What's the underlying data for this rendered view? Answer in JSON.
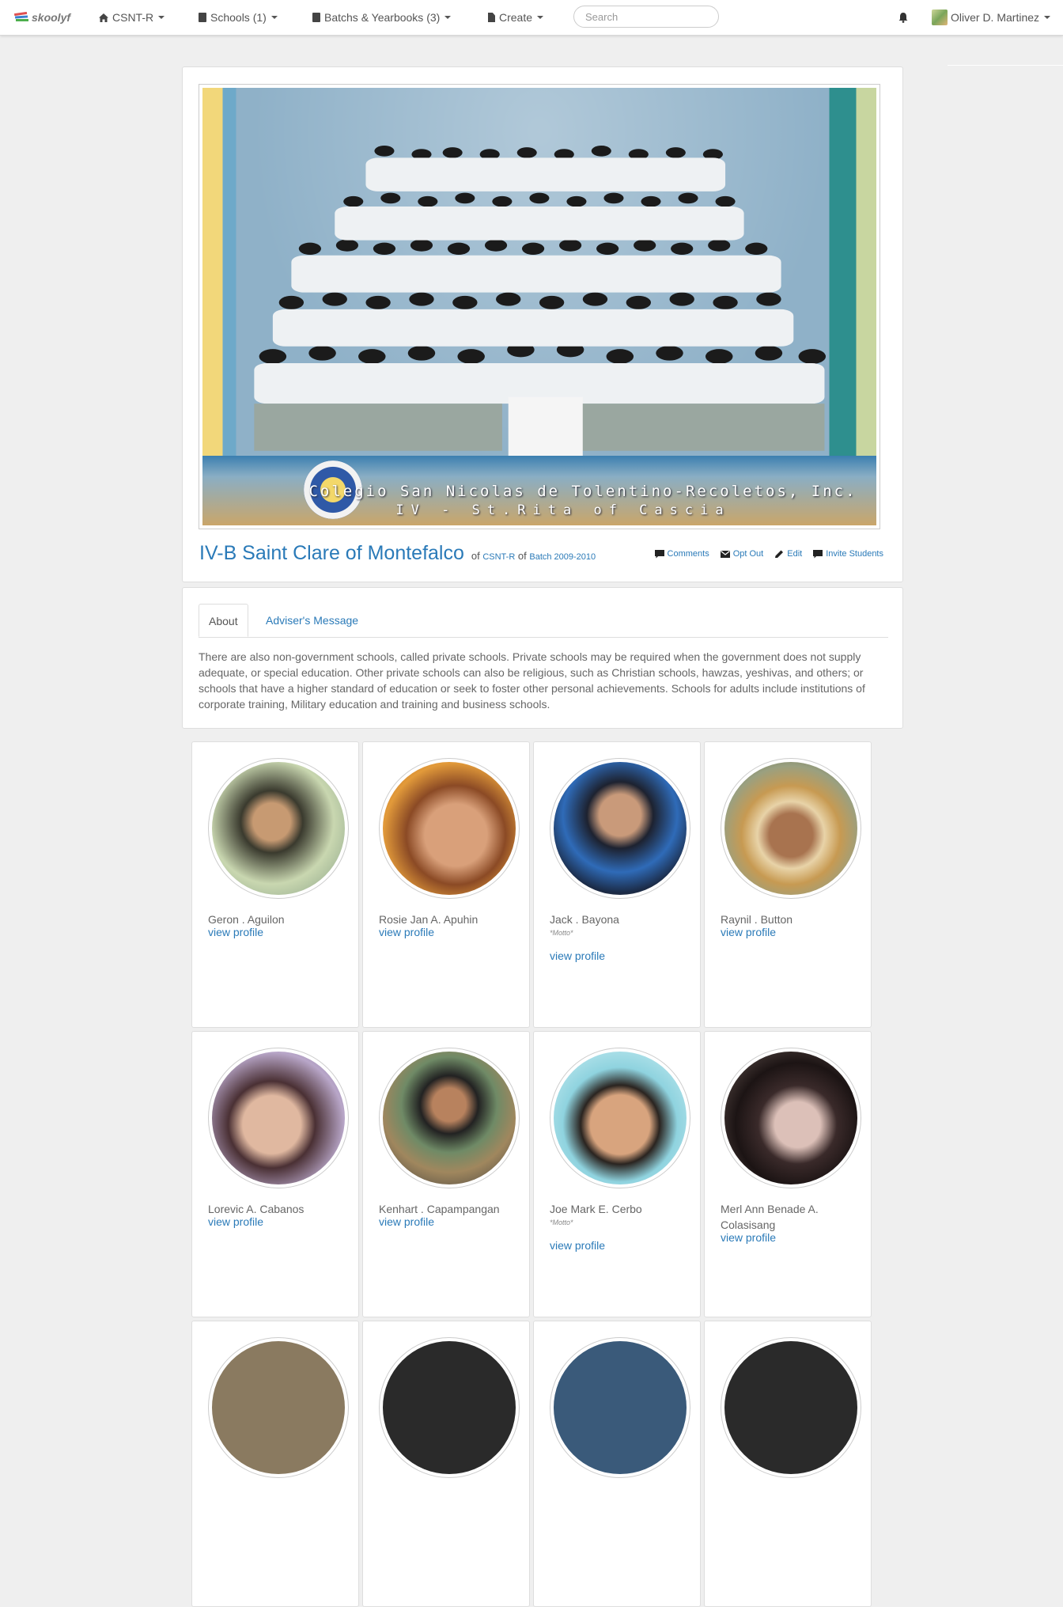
{
  "nav": {
    "brand": "skoolyf",
    "school_menu": "CSNT-R",
    "schools_menu": "Schools (1)",
    "batches_menu": "Batchs & Yearbooks (3)",
    "create_menu": "Create",
    "search_placeholder": "Search",
    "user_name": "Oliver D. Martinez"
  },
  "class": {
    "photo_caption_line1": "Colegio San Nicolas de Tolentino-Recoletos, Inc.",
    "photo_caption_line2": "IV - St.Rita of Cascia",
    "title": "IV-B Saint Clare of Montefalco",
    "of_1": "of",
    "school_link": "CSNT-R",
    "of_2": "of",
    "batch_link": "Batch 2009-2010",
    "actions": {
      "comments": "Comments",
      "opt_out": "Opt Out",
      "edit": "Edit",
      "invite": "Invite Students"
    }
  },
  "tabs": {
    "about": "About",
    "adviser": "Adviser's Message"
  },
  "about_text": "There are also non-government schools, called private schools. Private schools may be required when the government does not supply adequate, or special education. Other private schools can also be religious, such as Christian schools, hawzas, yeshivas, and others; or schools that have a higher standard of education or seek to foster other personal achievements. Schools for adults include institutions of corporate training, Military education and training and business schools.",
  "students": [
    {
      "name": "Geron . Aguilon",
      "motto": "",
      "link": "view profile"
    },
    {
      "name": "Rosie Jan A. Apuhin",
      "motto": "",
      "link": "view profile"
    },
    {
      "name": "Jack . Bayona",
      "motto": "*Motto*",
      "link": "view profile"
    },
    {
      "name": "Raynil . Button",
      "motto": "",
      "link": "view profile"
    },
    {
      "name": "Lorevic A. Cabanos",
      "motto": "",
      "link": "view profile"
    },
    {
      "name": "Kenhart . Capampangan",
      "motto": "",
      "link": "view profile"
    },
    {
      "name": "Joe Mark E. Cerbo",
      "motto": "*Motto*",
      "link": "view profile"
    },
    {
      "name": "Merl Ann Benade A. Colasisang",
      "motto": "",
      "link": "view profile"
    }
  ]
}
